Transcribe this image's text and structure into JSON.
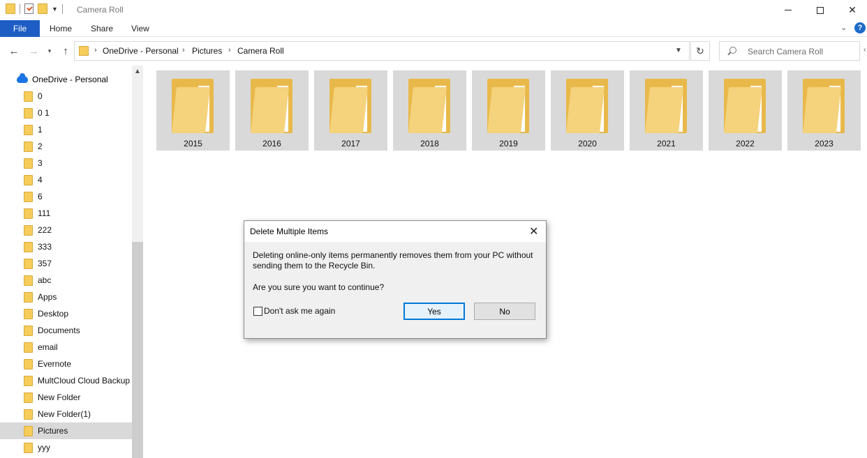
{
  "window": {
    "title": "Camera Roll",
    "controls": {
      "minimize_icon": "minimize-icon",
      "maximize_icon": "maximize-icon",
      "close_glyph": "✕"
    }
  },
  "ribbon": {
    "tabs": {
      "file": "File",
      "home": "Home",
      "share": "Share",
      "view": "View"
    },
    "help_glyph": "?",
    "accent_color": "#1e5ec4"
  },
  "address": {
    "crumbs": [
      "OneDrive - Personal",
      "Pictures",
      "Camera Roll"
    ],
    "search_placeholder": "Search Camera Roll"
  },
  "nav_pane": {
    "root": "OneDrive - Personal",
    "items": [
      "0",
      "0 1",
      "1",
      "2",
      "3",
      "4",
      "6",
      "111",
      "222",
      "333",
      "357",
      "abc",
      "Apps",
      "Desktop",
      "Documents",
      "email",
      "Evernote",
      "MultCloud Cloud Backup",
      "New Folder",
      "New Folder(1)",
      "Pictures",
      "yyy"
    ],
    "selected": "Pictures"
  },
  "folders": [
    "2015",
    "2016",
    "2017",
    "2018",
    "2019",
    "2020",
    "2021",
    "2022",
    "2023"
  ],
  "dialog": {
    "title": "Delete Multiple Items",
    "message": "Deleting online-only items permanently removes them from your PC without sending them to the Recycle Bin.",
    "question": "Are you sure you want to continue?",
    "checkbox_label": "Don't ask me again",
    "checkbox_checked": false,
    "yes_label": "Yes",
    "no_label": "No"
  }
}
